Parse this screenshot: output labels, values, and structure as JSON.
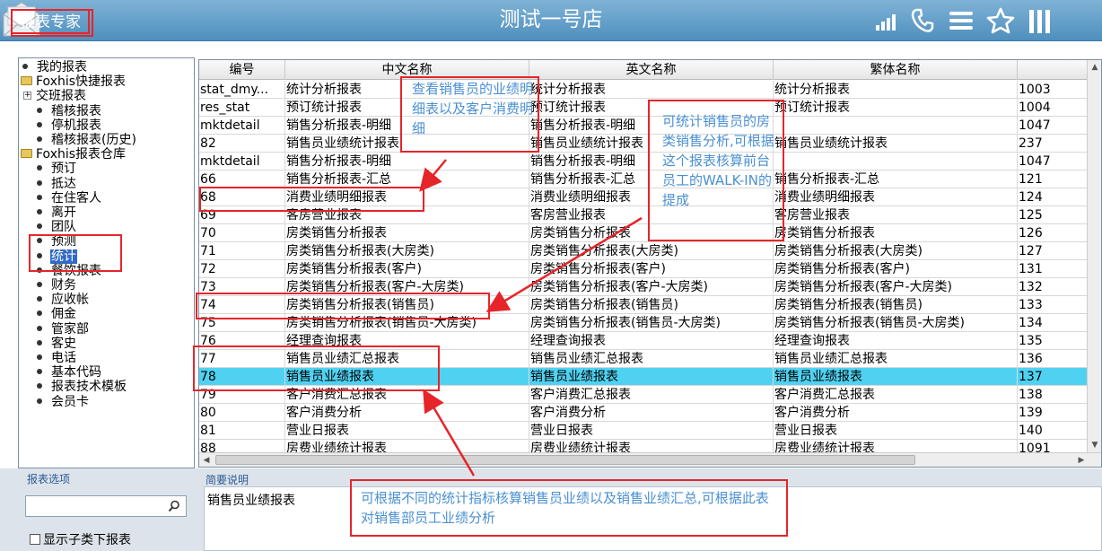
{
  "header": {
    "app_name": "报表专家",
    "store_name": "测试一号店"
  },
  "icons": {
    "signal": "signal-bars-icon",
    "phone": "phone-icon",
    "menu": "menu-icon",
    "star": "star-icon",
    "columns": "columns-icon",
    "mail": "mail-icon",
    "search": "search-icon"
  },
  "tree": [
    {
      "label": "我的报表",
      "type": "item",
      "level": 0
    },
    {
      "label": "Foxhis快捷报表",
      "type": "folder",
      "level": 0
    },
    {
      "label": "交班报表",
      "type": "expandable",
      "level": 1
    },
    {
      "label": "稽核报表",
      "type": "item",
      "level": 1
    },
    {
      "label": "停机报表",
      "type": "item",
      "level": 1
    },
    {
      "label": "稽核报表(历史)",
      "type": "item",
      "level": 1
    },
    {
      "label": "Foxhis报表仓库",
      "type": "folder",
      "level": 0
    },
    {
      "label": "预订",
      "type": "item",
      "level": 1
    },
    {
      "label": "抵达",
      "type": "item",
      "level": 1
    },
    {
      "label": "在住客人",
      "type": "item",
      "level": 1
    },
    {
      "label": "离开",
      "type": "item",
      "level": 1
    },
    {
      "label": "团队",
      "type": "item",
      "level": 1
    },
    {
      "label": "预测",
      "type": "item",
      "level": 1
    },
    {
      "label": "统计",
      "type": "item",
      "level": 1,
      "selected": true
    },
    {
      "label": "餐饮报表",
      "type": "item",
      "level": 1
    },
    {
      "label": "财务",
      "type": "item",
      "level": 1
    },
    {
      "label": "应收帐",
      "type": "item",
      "level": 1
    },
    {
      "label": "佣金",
      "type": "item",
      "level": 1
    },
    {
      "label": "管家部",
      "type": "item",
      "level": 1
    },
    {
      "label": "客史",
      "type": "item",
      "level": 1
    },
    {
      "label": "电话",
      "type": "item",
      "level": 1
    },
    {
      "label": "基本代码",
      "type": "item",
      "level": 1
    },
    {
      "label": "报表技术模板",
      "type": "item",
      "level": 1
    },
    {
      "label": "会员卡",
      "type": "item",
      "level": 1
    }
  ],
  "grid": {
    "columns": [
      "编号",
      "中文名称",
      "英文名称",
      "繁体名称",
      ""
    ],
    "rows": [
      [
        "stat_dmy...",
        "统计分析报表",
        "统计分析报表",
        "统计分析报表",
        "1003"
      ],
      [
        "res_stat",
        "预订统计报表",
        "预订统计报表",
        "预订统计报表",
        "1004"
      ],
      [
        "mktdetail",
        "销售分析报表-明细",
        "销售分析报表-明细",
        "",
        "1047"
      ],
      [
        "82",
        "销售员业绩统计报表",
        "销售员业绩统计报表",
        "销售员业绩统计报表",
        "237"
      ],
      [
        "mktdetail",
        "销售分析报表-明细",
        "销售分析报表-明细",
        "",
        "1047"
      ],
      [
        "66",
        "销售分析报表-汇总",
        "销售分析报表-汇总",
        "销售分析报表-汇总",
        "121"
      ],
      [
        "68",
        "消费业绩明细报表",
        "消费业绩明细报表",
        "消费业绩明细报表",
        "124"
      ],
      [
        "69",
        "客房营业报表",
        "客房营业报表",
        "客房营业报表",
        "125"
      ],
      [
        "70",
        "房类销售分析报表",
        "房类销售分析报表",
        "房类销售分析报表",
        "126"
      ],
      [
        "71",
        "房类销售分析报表(大房类)",
        "房类销售分析报表(大房类)",
        "房类销售分析报表(大房类)",
        "127"
      ],
      [
        "72",
        "房类销售分析报表(客户)",
        "房类销售分析报表(客户)",
        "房类销售分析报表(客户)",
        "131"
      ],
      [
        "73",
        "房类销售分析报表(客户-大房类)",
        "房类销售分析报表(客户-大房类)",
        "房类销售分析报表(客户-大房类)",
        "132"
      ],
      [
        "74",
        "房类销售分析报表(销售员)",
        "房类销售分析报表(销售员)",
        "房类销售分析报表(销售员)",
        "133"
      ],
      [
        "75",
        "房类销售分析报表(销售员-大房类)",
        "房类销售分析报表(销售员-大房类)",
        "房类销售分析报表(销售员-大房类)",
        "134"
      ],
      [
        "76",
        "经理查询报表",
        "经理查询报表",
        "经理查询报表",
        "135"
      ],
      [
        "77",
        "销售员业绩汇总报表",
        "销售员业绩汇总报表",
        "销售员业绩汇总报表",
        "136"
      ],
      [
        "78",
        "销售员业绩报表",
        "销售员业绩报表",
        "销售员业绩报表",
        "137"
      ],
      [
        "79",
        "客户消费汇总报表",
        "客户消费汇总报表",
        "客户消费汇总报表",
        "138"
      ],
      [
        "80",
        "客户消费分析",
        "客户消费分析",
        "客户消费分析",
        "139"
      ],
      [
        "81",
        "营业日报表",
        "营业日报表",
        "营业日报表",
        "140"
      ],
      [
        "88",
        "房费业绩统计报表",
        "房费业绩统计报表",
        "房费业绩统计报表",
        "1091"
      ]
    ],
    "selected_row": 16
  },
  "options": {
    "title": "报表选项",
    "search_placeholder": "",
    "show_sub_label": "显示子类下报表"
  },
  "description": {
    "title": "简要说明",
    "text": "销售员业绩报表"
  },
  "annotations": {
    "note1": "查看销售员的业绩明细表以及客户消费明细",
    "note2": "可统计销售员的房类销售分析,可根据这个报表核算前台员工的WALK-IN的提成",
    "note3": "可根据不同的统计指标核算销售员业绩以及销售业绩汇总,可根据此表对销售部员工业绩分析"
  },
  "colors": {
    "titlebar": "#5f9dc8",
    "selected_row": "#4fd2f2",
    "annotation_red": "#e5252a",
    "annotation_text": "#4a90d2",
    "tree_selected": "#316ac5"
  }
}
